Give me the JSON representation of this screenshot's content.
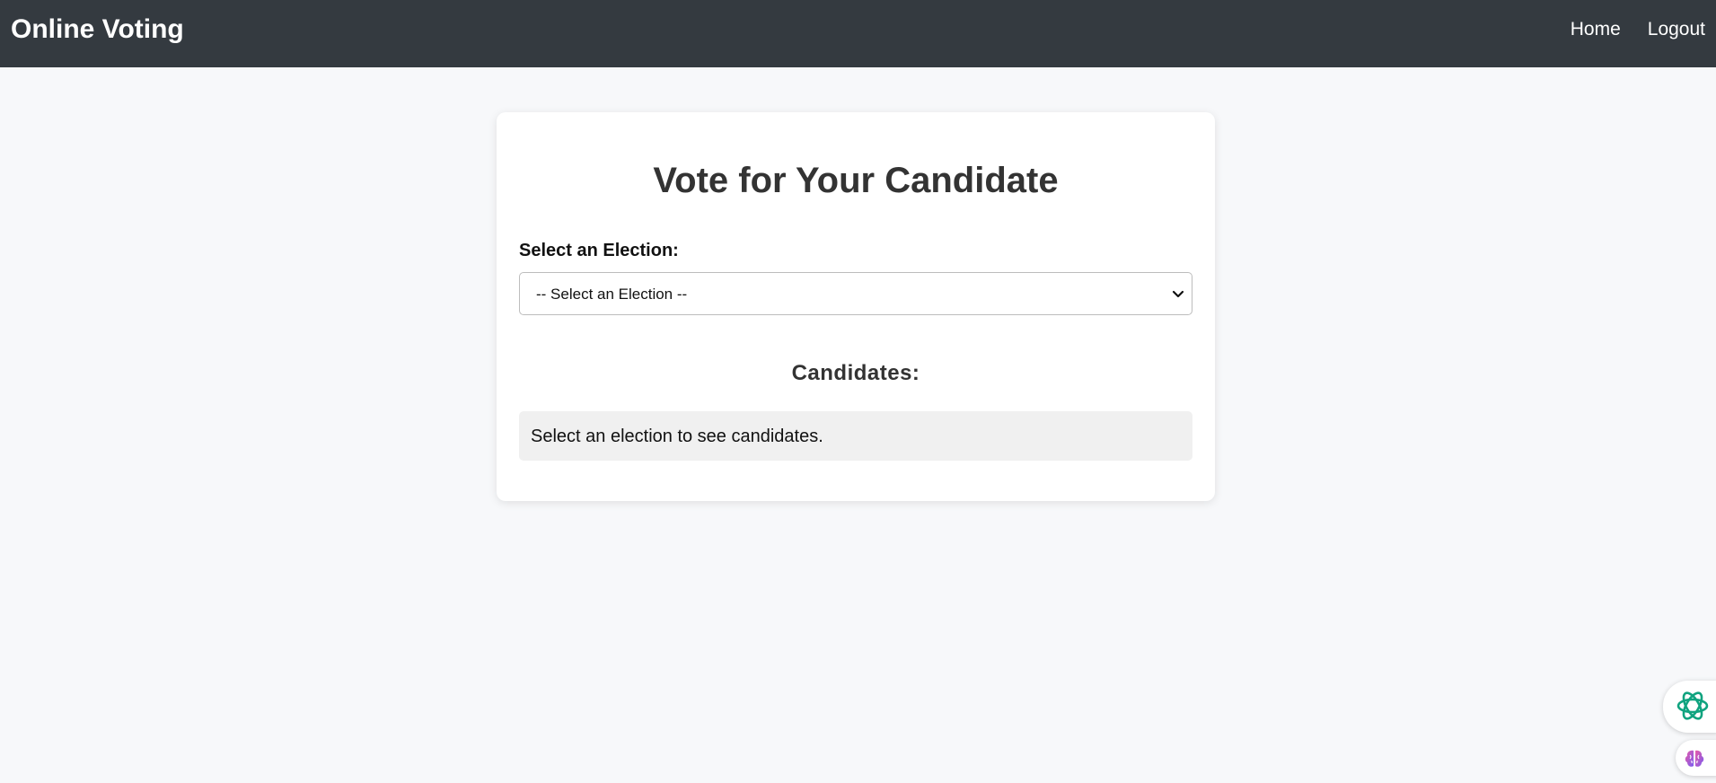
{
  "navbar": {
    "brand": "Online Voting",
    "links": [
      {
        "label": "Home"
      },
      {
        "label": "Logout"
      }
    ],
    "background": "#343a40"
  },
  "main": {
    "title": "Vote for Your Candidate",
    "election_select": {
      "label": "Select an Election:",
      "selected_value": "-- Select an Election --"
    },
    "candidates": {
      "heading": "Candidates:",
      "empty_message": "Select an election to see candidates."
    }
  },
  "floating_buttons": [
    {
      "icon": "assistant-knot-icon",
      "color": "#10a37f"
    },
    {
      "icon": "brain-icon",
      "color": "#b455e0"
    }
  ]
}
